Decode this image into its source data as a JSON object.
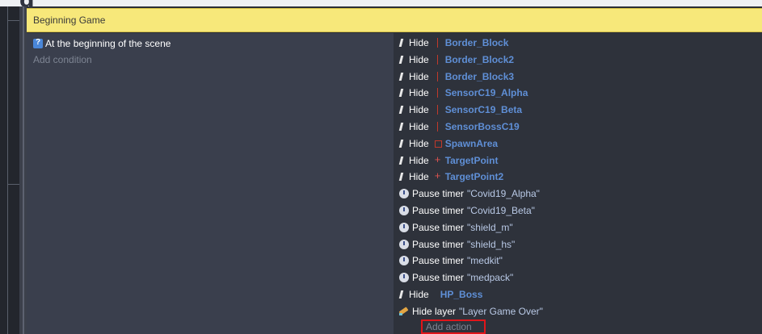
{
  "header_glyph": "g",
  "group": {
    "title": "Beginning Game"
  },
  "event": {
    "condition": {
      "icon": "scene-start-icon",
      "label": "At the beginning of the scene"
    },
    "add_condition_label": "Add condition",
    "actions": [
      {
        "icon": "hide-icon",
        "verb": "Hide",
        "object_icon": "border",
        "object": "Border_Block"
      },
      {
        "icon": "hide-icon",
        "verb": "Hide",
        "object_icon": "border",
        "object": "Border_Block2"
      },
      {
        "icon": "hide-icon",
        "verb": "Hide",
        "object_icon": "border",
        "object": "Border_Block3"
      },
      {
        "icon": "hide-icon",
        "verb": "Hide",
        "object_icon": "border",
        "object": "SensorC19_Alpha"
      },
      {
        "icon": "hide-icon",
        "verb": "Hide",
        "object_icon": "border",
        "object": "SensorC19_Beta"
      },
      {
        "icon": "hide-icon",
        "verb": "Hide",
        "object_icon": "border",
        "object": "SensorBossC19"
      },
      {
        "icon": "hide-icon",
        "verb": "Hide",
        "object_icon": "spawn",
        "object": "SpawnArea"
      },
      {
        "icon": "hide-icon",
        "verb": "Hide",
        "object_icon": "target",
        "object": "TargetPoint"
      },
      {
        "icon": "hide-icon",
        "verb": "Hide",
        "object_icon": "target",
        "object": "TargetPoint2"
      },
      {
        "icon": "timer-icon",
        "verb": "Pause timer",
        "string": "\"Covid19_Alpha\""
      },
      {
        "icon": "timer-icon",
        "verb": "Pause timer",
        "string": "\"Covid19_Beta\""
      },
      {
        "icon": "timer-icon",
        "verb": "Pause timer",
        "string": "\"shield_m\""
      },
      {
        "icon": "timer-icon",
        "verb": "Pause timer",
        "string": "\"shield_hs\""
      },
      {
        "icon": "timer-icon",
        "verb": "Pause timer",
        "string": "\"medkit\""
      },
      {
        "icon": "timer-icon",
        "verb": "Pause timer",
        "string": "\"medpack\""
      },
      {
        "icon": "hide-icon",
        "verb": "Hide",
        "object_icon": "none",
        "object": "HP_Boss"
      },
      {
        "icon": "layer-icon",
        "verb": "Hide layer",
        "string": "\"Layer Game Over\""
      }
    ],
    "add_action_label": "Add action"
  },
  "colors": {
    "group_header_bg": "#f7e87a",
    "conditions_bg": "#3a3f4d",
    "actions_bg": "#2e323b",
    "object_name": "#5f8fd6",
    "string_value": "#b9c9e6",
    "highlight_box": "#e0151a"
  }
}
